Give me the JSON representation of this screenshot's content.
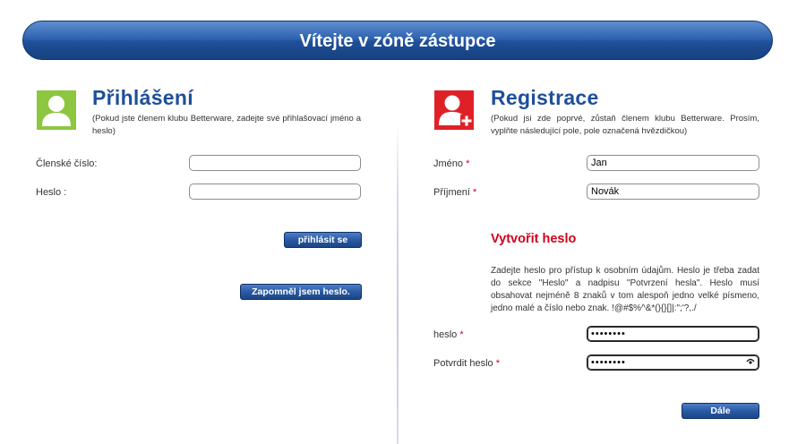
{
  "banner": {
    "title": "Vítejte v zóně zástupce"
  },
  "login": {
    "heading": "Přihlášení",
    "intro": "(Pokud jste členem klubu Betterware, zadejte své přihlašovací jméno a heslo)",
    "member_label": "Členské číslo:",
    "member_value": "",
    "password_label": "Heslo :",
    "password_value": "",
    "login_button": "přihlásit se",
    "forgot_button": "Zapomněl jsem heslo.",
    "icon": "user-icon",
    "icon_color": "#8dc63f"
  },
  "register": {
    "heading": "Registrace",
    "intro": "(Pokud jsi zde poprvé, zůstaň členem klubu Betterware. Prosím, vyplňte následující pole, pole označená hvězdičkou)",
    "first_name_label": "Jméno",
    "first_name_value": "Jan",
    "last_name_label": "Příjmení",
    "last_name_value": "Novák",
    "required_mark": "*",
    "create_password_heading": "Vytvořit heslo",
    "password_info": "Zadejte heslo pro přístup k osobním údajům. Heslo je třeba zadat do sekce \"Heslo\" a nadpisu \"Potvrzení hesla\". Heslo musí obsahovat nejméně 8 znaků v tom alespoň jedno velké písmeno, jedno malé a číslo nebo znak. !@#$%^&*(){}[]|:\";'?,./",
    "password_label": "heslo",
    "password_value": "••••••••",
    "confirm_label": "Potvrdit heslo",
    "confirm_value": "••••••••",
    "next_button": "Dále",
    "icon": "user-add-icon",
    "icon_color": "#e02027"
  }
}
